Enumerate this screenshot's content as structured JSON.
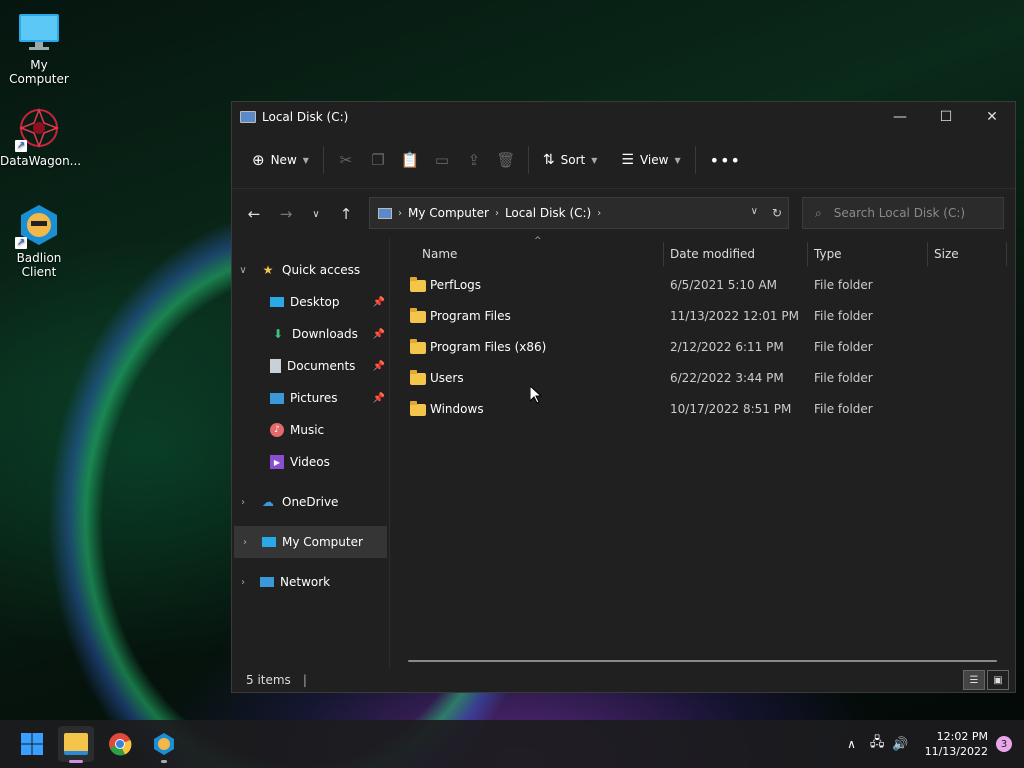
{
  "desktop": {
    "icons": [
      {
        "label": "My Computer"
      },
      {
        "label": "DataWagon..."
      },
      {
        "label": "Badlion Client"
      }
    ]
  },
  "window": {
    "title": "Local Disk (C:)",
    "toolbar": {
      "new_label": "New",
      "sort_label": "Sort",
      "view_label": "View"
    },
    "address": {
      "crumbs": [
        "My Computer",
        "Local Disk (C:)"
      ]
    },
    "search": {
      "placeholder": "Search Local Disk (C:)"
    },
    "sidebar": {
      "quick_access": "Quick access",
      "items": [
        {
          "label": "Desktop",
          "pinned": true,
          "icon": "desktop-icon"
        },
        {
          "label": "Downloads",
          "pinned": true,
          "icon": "download-icon"
        },
        {
          "label": "Documents",
          "pinned": true,
          "icon": "document-icon"
        },
        {
          "label": "Pictures",
          "pinned": true,
          "icon": "pictures-icon"
        },
        {
          "label": "Music",
          "pinned": false,
          "icon": "music-icon"
        },
        {
          "label": "Videos",
          "pinned": false,
          "icon": "videos-icon"
        }
      ],
      "onedrive": "OneDrive",
      "my_computer": "My Computer",
      "network": "Network"
    },
    "columns": {
      "name": "Name",
      "date": "Date modified",
      "type": "Type",
      "size": "Size"
    },
    "rows": [
      {
        "name": "PerfLogs",
        "date": "6/5/2021 5:10 AM",
        "type": "File folder"
      },
      {
        "name": "Program Files",
        "date": "11/13/2022 12:01 PM",
        "type": "File folder"
      },
      {
        "name": "Program Files (x86)",
        "date": "2/12/2022 6:11 PM",
        "type": "File folder"
      },
      {
        "name": "Users",
        "date": "6/22/2022 3:44 PM",
        "type": "File folder"
      },
      {
        "name": "Windows",
        "date": "10/17/2022 8:51 PM",
        "type": "File folder"
      }
    ],
    "status": {
      "item_count": "5 items"
    }
  },
  "taskbar": {
    "time": "12:02 PM",
    "date": "11/13/2022",
    "notifications": "3"
  },
  "colors": {
    "accent": "#0078d4",
    "folder": "#f3c64b",
    "window_bg": "#202020"
  }
}
